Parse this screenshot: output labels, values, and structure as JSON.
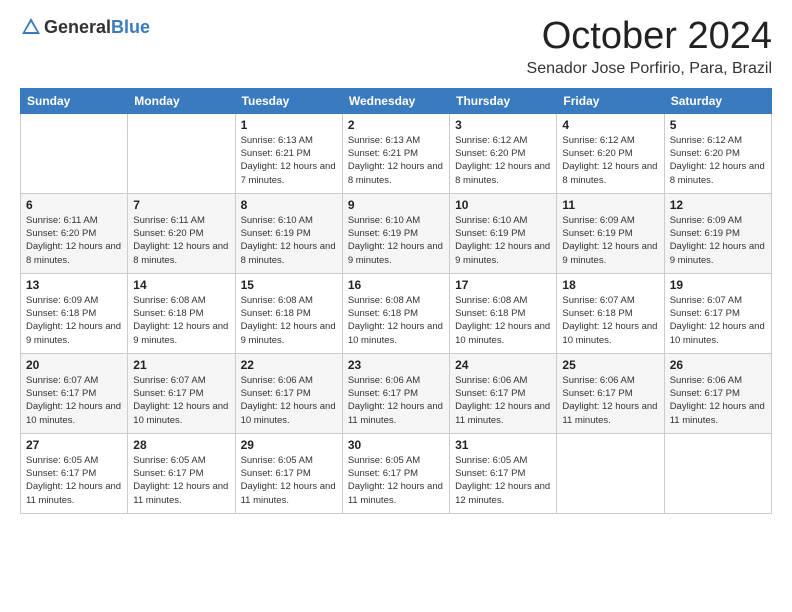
{
  "header": {
    "logo": {
      "general": "General",
      "blue": "Blue"
    },
    "month": "October 2024",
    "location": "Senador Jose Porfirio, Para, Brazil"
  },
  "weekdays": [
    "Sunday",
    "Monday",
    "Tuesday",
    "Wednesday",
    "Thursday",
    "Friday",
    "Saturday"
  ],
  "weeks": [
    [
      {
        "day": null,
        "info": null
      },
      {
        "day": null,
        "info": null
      },
      {
        "day": "1",
        "info": "Sunrise: 6:13 AM\nSunset: 6:21 PM\nDaylight: 12 hours and 7 minutes."
      },
      {
        "day": "2",
        "info": "Sunrise: 6:13 AM\nSunset: 6:21 PM\nDaylight: 12 hours and 8 minutes."
      },
      {
        "day": "3",
        "info": "Sunrise: 6:12 AM\nSunset: 6:20 PM\nDaylight: 12 hours and 8 minutes."
      },
      {
        "day": "4",
        "info": "Sunrise: 6:12 AM\nSunset: 6:20 PM\nDaylight: 12 hours and 8 minutes."
      },
      {
        "day": "5",
        "info": "Sunrise: 6:12 AM\nSunset: 6:20 PM\nDaylight: 12 hours and 8 minutes."
      }
    ],
    [
      {
        "day": "6",
        "info": "Sunrise: 6:11 AM\nSunset: 6:20 PM\nDaylight: 12 hours and 8 minutes."
      },
      {
        "day": "7",
        "info": "Sunrise: 6:11 AM\nSunset: 6:20 PM\nDaylight: 12 hours and 8 minutes."
      },
      {
        "day": "8",
        "info": "Sunrise: 6:10 AM\nSunset: 6:19 PM\nDaylight: 12 hours and 8 minutes."
      },
      {
        "day": "9",
        "info": "Sunrise: 6:10 AM\nSunset: 6:19 PM\nDaylight: 12 hours and 9 minutes."
      },
      {
        "day": "10",
        "info": "Sunrise: 6:10 AM\nSunset: 6:19 PM\nDaylight: 12 hours and 9 minutes."
      },
      {
        "day": "11",
        "info": "Sunrise: 6:09 AM\nSunset: 6:19 PM\nDaylight: 12 hours and 9 minutes."
      },
      {
        "day": "12",
        "info": "Sunrise: 6:09 AM\nSunset: 6:19 PM\nDaylight: 12 hours and 9 minutes."
      }
    ],
    [
      {
        "day": "13",
        "info": "Sunrise: 6:09 AM\nSunset: 6:18 PM\nDaylight: 12 hours and 9 minutes."
      },
      {
        "day": "14",
        "info": "Sunrise: 6:08 AM\nSunset: 6:18 PM\nDaylight: 12 hours and 9 minutes."
      },
      {
        "day": "15",
        "info": "Sunrise: 6:08 AM\nSunset: 6:18 PM\nDaylight: 12 hours and 9 minutes."
      },
      {
        "day": "16",
        "info": "Sunrise: 6:08 AM\nSunset: 6:18 PM\nDaylight: 12 hours and 10 minutes."
      },
      {
        "day": "17",
        "info": "Sunrise: 6:08 AM\nSunset: 6:18 PM\nDaylight: 12 hours and 10 minutes."
      },
      {
        "day": "18",
        "info": "Sunrise: 6:07 AM\nSunset: 6:18 PM\nDaylight: 12 hours and 10 minutes."
      },
      {
        "day": "19",
        "info": "Sunrise: 6:07 AM\nSunset: 6:17 PM\nDaylight: 12 hours and 10 minutes."
      }
    ],
    [
      {
        "day": "20",
        "info": "Sunrise: 6:07 AM\nSunset: 6:17 PM\nDaylight: 12 hours and 10 minutes."
      },
      {
        "day": "21",
        "info": "Sunrise: 6:07 AM\nSunset: 6:17 PM\nDaylight: 12 hours and 10 minutes."
      },
      {
        "day": "22",
        "info": "Sunrise: 6:06 AM\nSunset: 6:17 PM\nDaylight: 12 hours and 10 minutes."
      },
      {
        "day": "23",
        "info": "Sunrise: 6:06 AM\nSunset: 6:17 PM\nDaylight: 12 hours and 11 minutes."
      },
      {
        "day": "24",
        "info": "Sunrise: 6:06 AM\nSunset: 6:17 PM\nDaylight: 12 hours and 11 minutes."
      },
      {
        "day": "25",
        "info": "Sunrise: 6:06 AM\nSunset: 6:17 PM\nDaylight: 12 hours and 11 minutes."
      },
      {
        "day": "26",
        "info": "Sunrise: 6:06 AM\nSunset: 6:17 PM\nDaylight: 12 hours and 11 minutes."
      }
    ],
    [
      {
        "day": "27",
        "info": "Sunrise: 6:05 AM\nSunset: 6:17 PM\nDaylight: 12 hours and 11 minutes."
      },
      {
        "day": "28",
        "info": "Sunrise: 6:05 AM\nSunset: 6:17 PM\nDaylight: 12 hours and 11 minutes."
      },
      {
        "day": "29",
        "info": "Sunrise: 6:05 AM\nSunset: 6:17 PM\nDaylight: 12 hours and 11 minutes."
      },
      {
        "day": "30",
        "info": "Sunrise: 6:05 AM\nSunset: 6:17 PM\nDaylight: 12 hours and 11 minutes."
      },
      {
        "day": "31",
        "info": "Sunrise: 6:05 AM\nSunset: 6:17 PM\nDaylight: 12 hours and 12 minutes."
      },
      {
        "day": null,
        "info": null
      },
      {
        "day": null,
        "info": null
      }
    ]
  ]
}
